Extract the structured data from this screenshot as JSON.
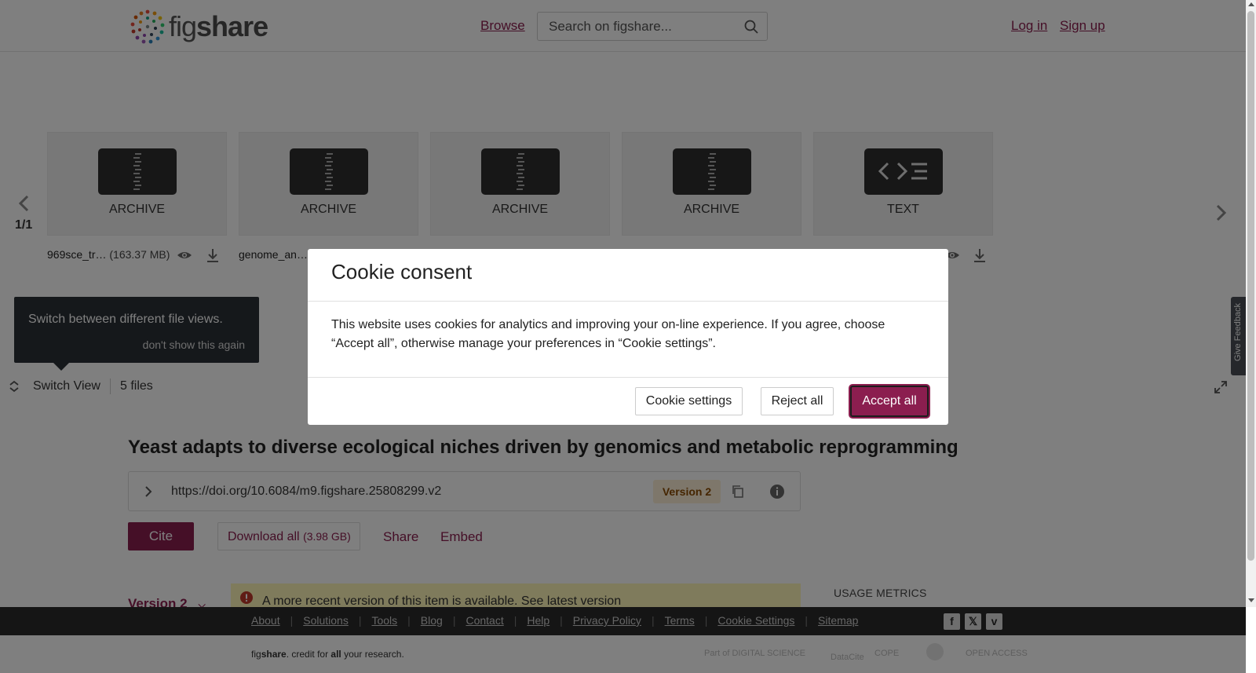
{
  "header": {
    "logo_alt": "figshare",
    "logo_text_light": "fig",
    "logo_text_bold": "share",
    "browse": "Browse",
    "search_placeholder": "Search on figshare...",
    "login": "Log in",
    "signup": "Sign up"
  },
  "files": {
    "page_indicator": "1/1",
    "cards": [
      {
        "type": "ARCHIVE",
        "icon": "zip-icon",
        "name": "969sce_tr…",
        "size": "(163.37 MB)"
      },
      {
        "type": "ARCHIVE",
        "icon": "zip-icon",
        "name": "genome_an…",
        "size": ""
      },
      {
        "type": "ARCHIVE",
        "icon": "zip-icon",
        "name": "",
        "size": ""
      },
      {
        "type": "ARCHIVE",
        "icon": "zip-icon",
        "name": "",
        "size": ""
      },
      {
        "type": "TEXT",
        "icon": "code-icon",
        "name": "",
        "size": ""
      }
    ],
    "tooltip_text": "Switch between different file views.",
    "tooltip_dismiss": "don't show this again",
    "switch_view": "Switch View",
    "files_count": "5 files"
  },
  "article": {
    "title": "Yeast adapts to diverse ecological niches driven by genomics and metabolic reprogramming",
    "doi": "https://doi.org/10.6084/m9.figshare.25808299.v2",
    "version_badge": "Version 2",
    "cite": "Cite",
    "download_all": "Download all",
    "download_size": "(3.98 GB)",
    "share": "Share",
    "embed": "Embed",
    "version_toggle": "Version 2",
    "notice": "A more recent version of this item is available. See latest version",
    "usage_metrics": "USAGE METRICS"
  },
  "footer": {
    "links": [
      "About",
      "Solutions",
      "Tools",
      "Blog",
      "Contact",
      "Help",
      "Privacy Policy",
      "Terms",
      "Cookie Settings",
      "Sitemap"
    ],
    "social": [
      "f",
      "𝕏",
      "v"
    ],
    "tagline_prefix": "fig",
    "tagline_bold": "share",
    "tagline_mid": ". credit for ",
    "tagline_all": "all",
    "tagline_end": " your research.",
    "partners": [
      "Part of DIGITAL SCIENCE",
      "DataCite",
      "COPE",
      "",
      "OPEN ACCESS"
    ]
  },
  "feedback": "Give Feedback",
  "cookie": {
    "title": "Cookie consent",
    "body": "This website uses cookies for analytics and improving your on-line experience. If you agree, choose “Accept all”, otherwise manage your preferences in “Cookie settings”.",
    "settings": "Cookie settings",
    "reject": "Reject all",
    "accept": "Accept all"
  },
  "colors": {
    "brand": "#8b1e4f",
    "dark": "#2b2b2b",
    "notice_bg": "#fff7b8"
  }
}
